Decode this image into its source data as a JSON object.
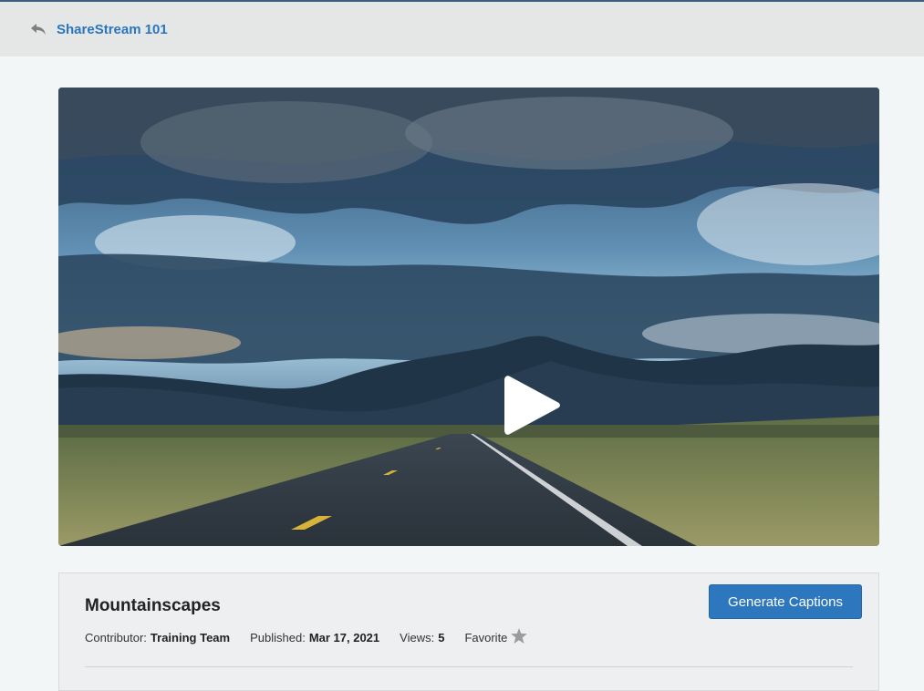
{
  "header": {
    "back_label": "ShareStream 101",
    "back_icon": "reply-arrow-icon"
  },
  "video": {
    "thumbnail_description_icon": "play-icon",
    "colors": {
      "sky_top": "#3b5d7c",
      "sky_light": "#b9d6e6",
      "clouds": "#2a4562",
      "mountains": "#1f3345",
      "grass": "#7a8a5a",
      "road": "#2f3a44"
    }
  },
  "details": {
    "title": "Mountainscapes",
    "generate_captions_label": "Generate Captions",
    "contributor_label": "Contributor:",
    "contributor_value": "Training Team",
    "published_label": "Published:",
    "published_value": "Mar 17, 2021",
    "views_label": "Views:",
    "views_value": "5",
    "favorite_label": "Favorite",
    "favorite_icon": "star-icon",
    "accent_color": "#2d77bf"
  }
}
